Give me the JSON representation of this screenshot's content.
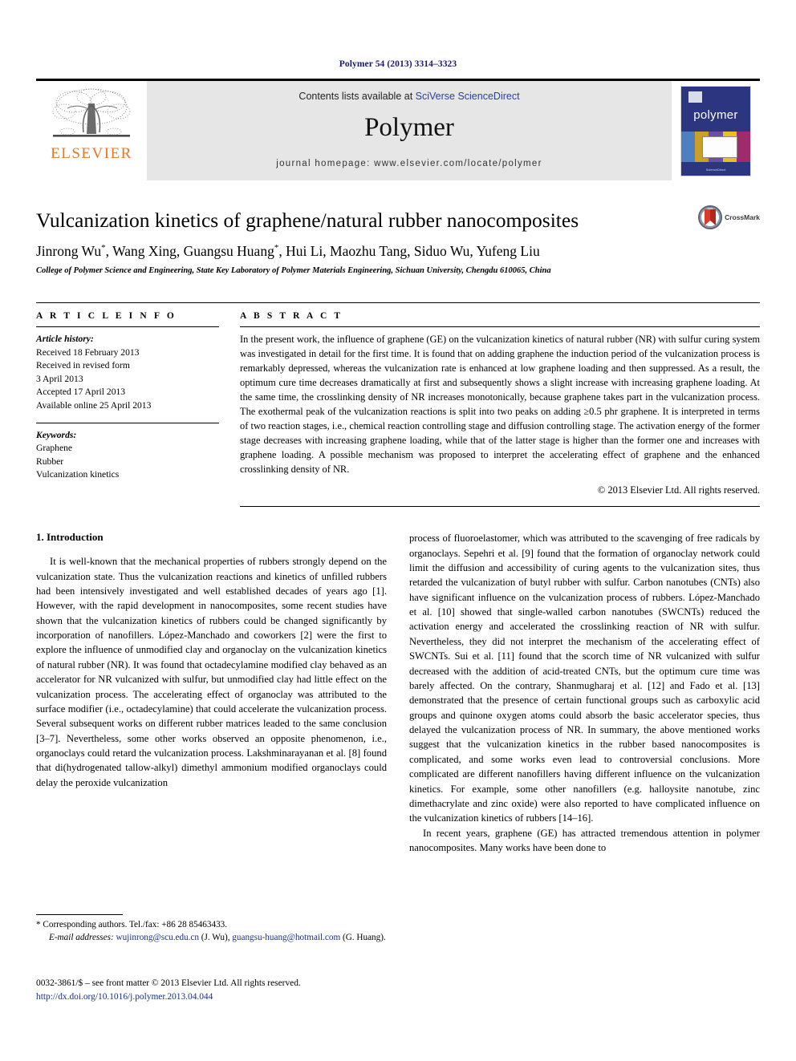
{
  "running_head": "Polymer 54 (2013) 3314–3323",
  "masthead": {
    "publisher_name": "ELSEVIER",
    "contents_prefix": "Contents lists available at ",
    "contents_link": "SciVerse ScienceDirect",
    "journal_name": "Polymer",
    "homepage": "journal homepage: www.elsevier.com/locate/polymer",
    "cover_title": "polymer"
  },
  "title": "Vulcanization kinetics of graphene/natural rubber nanocomposites",
  "crossmark_label": "CrossMark",
  "authors": "Jinrong Wu*, Wang Xing, Guangsu Huang*, Hui Li, Maozhu Tang, Siduo Wu, Yufeng Liu",
  "affiliation": "College of Polymer Science and Engineering, State Key Laboratory of Polymer Materials Engineering, Sichuan University, Chengdu 610065, China",
  "article_info": {
    "heading": "A R T I C L E   I N F O",
    "history_label": "Article history:",
    "history": [
      "Received 18 February 2013",
      "Received in revised form",
      "3 April 2013",
      "Accepted 17 April 2013",
      "Available online 25 April 2013"
    ],
    "keywords_label": "Keywords:",
    "keywords": [
      "Graphene",
      "Rubber",
      "Vulcanization kinetics"
    ]
  },
  "abstract": {
    "heading": "A B S T R A C T",
    "text": "In the present work, the influence of graphene (GE) on the vulcanization kinetics of natural rubber (NR) with sulfur curing system was investigated in detail for the first time. It is found that on adding graphene the induction period of the vulcanization process is remarkably depressed, whereas the vulcanization rate is enhanced at low graphene loading and then suppressed. As a result, the optimum cure time decreases dramatically at first and subsequently shows a slight increase with increasing graphene loading. At the same time, the crosslinking density of NR increases monotonically, because graphene takes part in the vulcanization process. The exothermal peak of the vulcanization reactions is split into two peaks on adding ≥0.5 phr graphene. It is interpreted in terms of two reaction stages, i.e., chemical reaction controlling stage and diffusion controlling stage. The activation energy of the former stage decreases with increasing graphene loading, while that of the latter stage is higher than the former one and increases with graphene loading. A possible mechanism was proposed to interpret the accelerating effect of graphene and the enhanced crosslinking density of NR.",
    "copyright": "© 2013 Elsevier Ltd. All rights reserved."
  },
  "body": {
    "section_heading": "1.  Introduction",
    "left_paragraphs": [
      "It is well-known that the mechanical properties of rubbers strongly depend on the vulcanization state. Thus the vulcanization reactions and kinetics of unfilled rubbers had been intensively investigated and well established decades of years ago [1]. However, with the rapid development in nanocomposites, some recent studies have shown that the vulcanization kinetics of rubbers could be changed significantly by incorporation of nanofillers. López-Manchado and coworkers [2] were the first to explore the influence of unmodified clay and organoclay on the vulcanization kinetics of natural rubber (NR). It was found that octadecylamine modified clay behaved as an accelerator for NR vulcanized with sulfur, but unmodified clay had little effect on the vulcanization process. The accelerating effect of organoclay was attributed to the surface modifier (i.e., octadecylamine) that could accelerate the vulcanization process. Several subsequent works on different rubber matrices leaded to the same conclusion [3–7]. Nevertheless, some other works observed an opposite phenomenon, i.e., organoclays could retard the vulcanization process. Lakshminarayanan et al. [8] found that di(hydrogenated tallow-alkyl) dimethyl ammonium modified organoclays could delay the peroxide vulcanization"
    ],
    "right_paragraphs": [
      "process of fluoroelastomer, which was attributed to the scavenging of free radicals by organoclays. Sepehri et al. [9] found that the formation of organoclay network could limit the diffusion and accessibility of curing agents to the vulcanization sites, thus retarded the vulcanization of butyl rubber with sulfur. Carbon nanotubes (CNTs) also have significant influence on the vulcanization process of rubbers. López-Manchado et al. [10] showed that single-walled carbon nanotubes (SWCNTs) reduced the activation energy and accelerated the crosslinking reaction of NR with sulfur. Nevertheless, they did not interpret the mechanism of the accelerating effect of SWCNTs. Sui et al. [11] found that the scorch time of NR vulcanized with sulfur decreased with the addition of acid-treated CNTs, but the optimum cure time was barely affected. On the contrary, Shanmugharaj et al. [12] and Fadо et al. [13] demonstrated that the presence of certain functional groups such as carboxylic acid groups and quinone oxygen atoms could absorb the basic accelerator species, thus delayed the vulcanization process of NR. In summary, the above mentioned works suggest that the vulcanization kinetics in the rubber based nanocomposites is complicated, and some works even lead to controversial conclusions. More complicated are different nanofillers having different influence on the vulcanization kinetics. For example, some other nanofillers (e.g. halloysite nanotube, zinc dimethacrylate and zinc oxide) were also reported to have complicated influence on the vulcanization kinetics of rubbers [14–16].",
      "In recent years, graphene (GE) has attracted tremendous attention in polymer nanocomposites. Many works have been done to"
    ]
  },
  "footnotes": {
    "corresponding": "* Corresponding authors. Tel./fax: +86 28 85463433.",
    "email_label": "E-mail addresses:",
    "email_1": "wujinrong@scu.edu.cn",
    "email_1_owner": "(J. Wu),",
    "email_2": "guangsu-huang@hotmail.com",
    "email_2_owner": "(G. Huang)."
  },
  "issn_line": "0032-3861/$ – see front matter © 2013 Elsevier Ltd. All rights reserved.",
  "doi": "http://dx.doi.org/10.1016/j.polymer.2013.04.044",
  "colors": {
    "link_blue": "#1a2f87",
    "elsevier_orange": "#E87722",
    "masthead_grey": "#e6e6e6",
    "cover_blue": "#2b3580"
  }
}
